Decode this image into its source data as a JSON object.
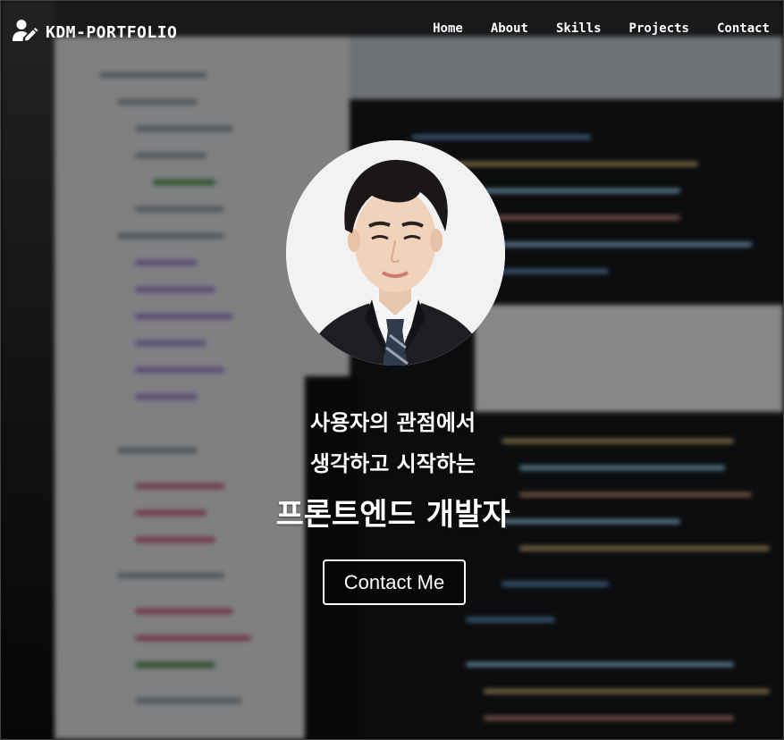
{
  "header": {
    "logo_text": "KDM-PORTFOLIO",
    "logo_icon": "user-edit-icon"
  },
  "nav": {
    "items": [
      {
        "label": "Home"
      },
      {
        "label": "About"
      },
      {
        "label": "Skills"
      },
      {
        "label": "Projects"
      },
      {
        "label": "Contact"
      }
    ]
  },
  "hero": {
    "tagline_line1": "사용자의 관점에서",
    "tagline_line2": "생각하고 시작하는",
    "tagline_line3": "프론트엔드 개발자",
    "contact_button": "Contact Me"
  },
  "colors": {
    "text": "#ffffff",
    "overlay": "#000000",
    "button_border": "#ffffff"
  }
}
